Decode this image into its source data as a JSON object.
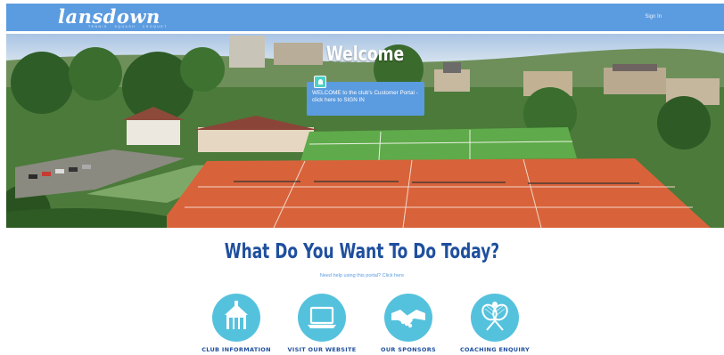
{
  "header": {
    "logo_text": "lansdown",
    "logo_subtext": "TENNIS · SQUASH · CROQUET",
    "signin_label": "Sign In"
  },
  "hero": {
    "title": "Welcome",
    "callout_text": "WELCOME to the club's Customer Portal - click here to SIGN IN"
  },
  "main": {
    "heading": "What Do You Want To Do Today?",
    "help_text": "Need help using this portal? Click here"
  },
  "tiles": [
    {
      "label": "CLUB INFORMATION",
      "icon": "clubhouse-icon"
    },
    {
      "label": "VISIT OUR WEBSITE",
      "icon": "laptop-icon"
    },
    {
      "label": "OUR SPONSORS",
      "icon": "handshake-icon"
    },
    {
      "label": "COACHING ENQUIRY",
      "icon": "tennis-rackets-icon"
    }
  ],
  "colors": {
    "header_bg": "#5b9be0",
    "heading": "#1f4f9e",
    "tile_circle": "#55c2dd",
    "clay_court": "#d8633a",
    "grass_court": "#5faa4a"
  }
}
